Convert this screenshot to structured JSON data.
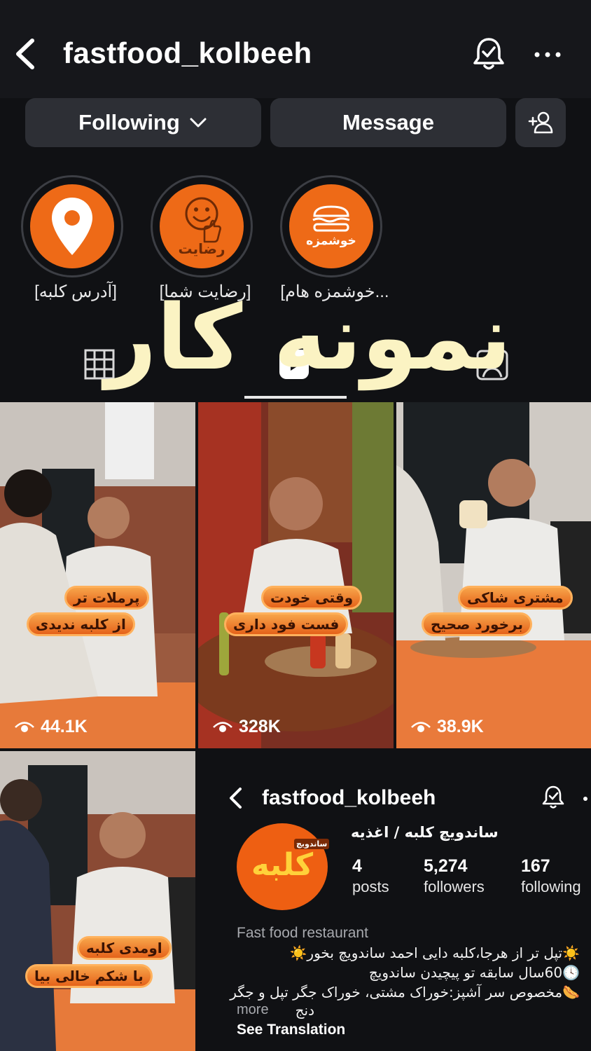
{
  "header": {
    "username": "fastfood_kolbeeh"
  },
  "actions": {
    "following_label": "Following",
    "message_label": "Message"
  },
  "highlights": [
    {
      "label": "[آدرس کلبه]",
      "badge": ""
    },
    {
      "label": "[رضایت شما]",
      "badge": "رضایت"
    },
    {
      "label": "[خوشمزه هام...",
      "badge": "خوشمزه"
    }
  ],
  "overlay": {
    "watermark": "نمونه کار"
  },
  "reels": [
    {
      "caption_top": "پرملات تر",
      "caption_bottom": "از کلبه ندیدی",
      "views": "44.1K"
    },
    {
      "caption_top": "وقتی خودت",
      "caption_bottom": "فست فود داری",
      "views": "328K"
    },
    {
      "caption_top": "مشتری شاکی",
      "caption_bottom": "برخورد صحیح",
      "views": "38.9K"
    },
    {
      "caption_top": "اومدی کلبه",
      "caption_bottom": "با شکم خالی بیا"
    }
  ],
  "embedded_profile": {
    "username": "fastfood_kolbeeh",
    "logo_text": "کلبه",
    "logo_sub": "ساندویچ",
    "name": "ساندویچ کلبه / اغذیه",
    "stats": [
      {
        "value": "4",
        "label": "posts"
      },
      {
        "value": "5,274",
        "label": "followers"
      },
      {
        "value": "167",
        "label": "following"
      }
    ],
    "category": "Fast food restaurant",
    "bio": [
      "☀️تپل تر از هرجا،کلبه دایی احمد ساندویچ بخور☀️",
      "🕓60سال سابقه تو پیچیدن ساندویچ",
      "🌭مخصوص سر آشپز:خوراک مشتی، خوراک جگر تپل و جگر",
      "دنج"
    ],
    "more_label": "more",
    "see_translation": "See Translation"
  },
  "colors": {
    "accent": "#ee6a17",
    "background": "#101114",
    "button": "#2d2f35",
    "watermark": "#fbf3c3"
  }
}
